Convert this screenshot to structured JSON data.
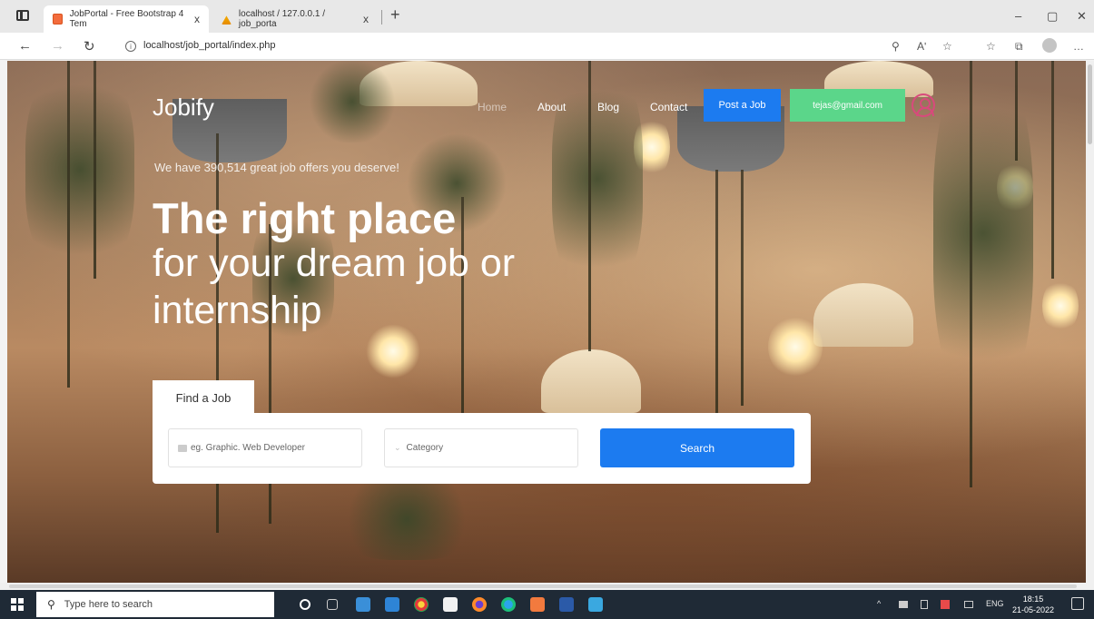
{
  "browser": {
    "tabs": [
      {
        "label": "JobPortal - Free Bootstrap 4 Tem",
        "active": true
      },
      {
        "label": "localhost / 127.0.0.1 / job_porta",
        "active": false
      }
    ],
    "tab_close": "x",
    "new_tab": "+",
    "window_controls": {
      "minimize": "–",
      "maximize": "▢",
      "close": "✕"
    },
    "url": "localhost/job_portal/index.php",
    "nav": {
      "back": "←",
      "forward": "→",
      "refresh": "↻",
      "info": "i"
    },
    "toolbar_icons": [
      "zoom-icon",
      "read-aloud-icon",
      "favorite-add-icon",
      "favorites-icon",
      "collections-icon",
      "profile-icon",
      "more-icon"
    ],
    "toolbar_glyphs": {
      "zoom": "⚲",
      "read_aloud": "Aʹ",
      "favorite_add": "☆",
      "favorites": "☆",
      "collections": "⧉",
      "more": "…"
    }
  },
  "site": {
    "logo": "Jobify",
    "nav": [
      {
        "label": "Home",
        "active": false
      },
      {
        "label": "About",
        "active": true
      },
      {
        "label": "Blog",
        "active": true
      },
      {
        "label": "Contact",
        "active": true
      }
    ],
    "post_job": "Post a Job",
    "user_email": "tejas@gmail.com"
  },
  "hero": {
    "tagline": "We have 390,514 great job offers you deserve!",
    "headline": "The right place",
    "subhead": "for your dream job or internship"
  },
  "search": {
    "tab_label": "Find a Job",
    "keyword_placeholder": "eg. Graphic. Web Developer",
    "category_placeholder": "Category",
    "button": "Search"
  },
  "taskbar": {
    "search_placeholder": "Type here to search",
    "tray_lang": "ENG",
    "time": "18:15",
    "date": "21-05-2022",
    "tray_caret": "^"
  },
  "colors": {
    "primary": "#1c7bf0",
    "success": "#5bd68a",
    "taskbar": "#1f2a36"
  }
}
